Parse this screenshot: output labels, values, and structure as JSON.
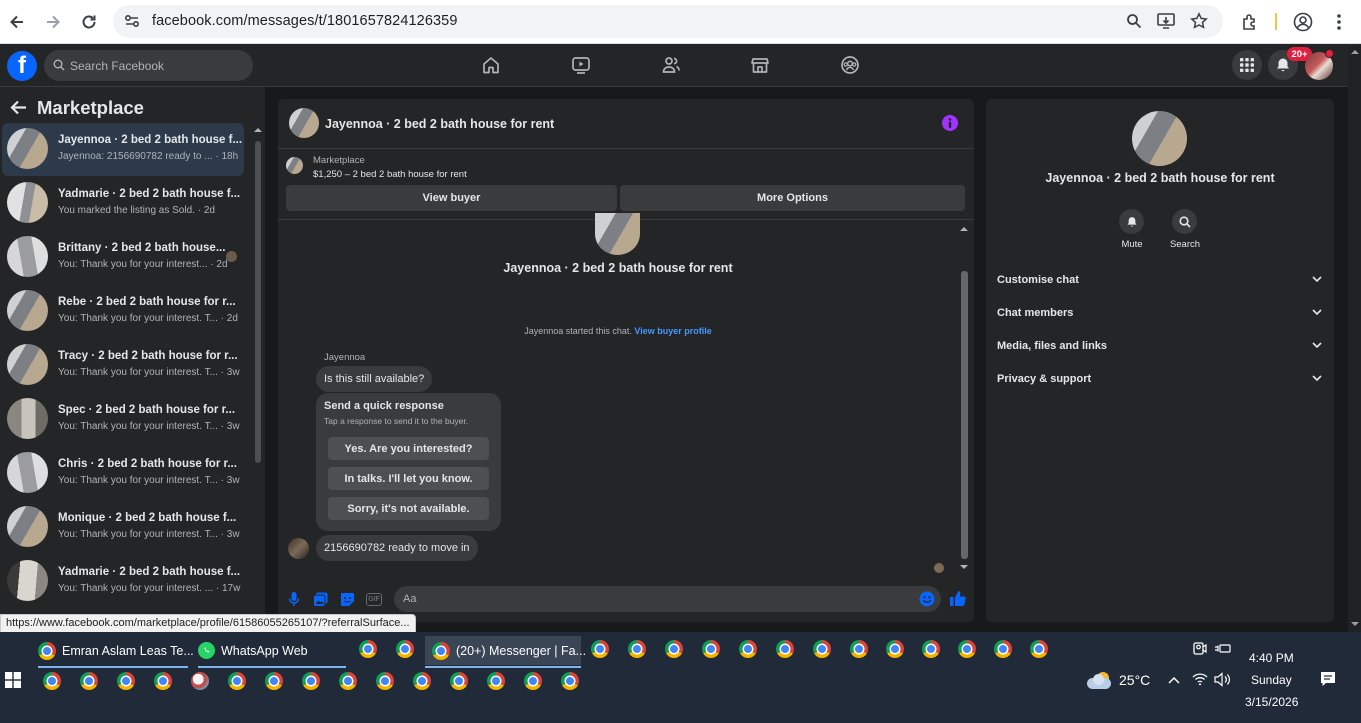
{
  "browser": {
    "url": "facebook.com/messages/t/1801657824126359"
  },
  "fb_header": {
    "search_placeholder": "Search Facebook",
    "notification_badge": "20+"
  },
  "sidebar": {
    "title": "Marketplace",
    "conversations": [
      {
        "title": "Jayennoa · 2 bed 2 bath house f...",
        "subtitle": "Jayennoa: 2156690782 ready to ... · 18h"
      },
      {
        "title": "Yadmarie · 2 bed 2 bath house f...",
        "subtitle": "You marked the listing as Sold. · 2d"
      },
      {
        "title": "Brittany · 2 bed 2 bath house...",
        "subtitle": "You: Thank you for your interest... · 2d"
      },
      {
        "title": "Rebe · 2 bed 2 bath house for r...",
        "subtitle": "You: Thank you for your interest. T... · 2d"
      },
      {
        "title": "Tracy · 2 bed 2 bath house for r...",
        "subtitle": "You: Thank you for your interest. T... · 3w"
      },
      {
        "title": "Spec · 2 bed 2 bath house for r...",
        "subtitle": "You: Thank you for your interest. T... · 3w"
      },
      {
        "title": "Chris · 2 bed 2 bath house for r...",
        "subtitle": "You: Thank you for your interest. T... · 3w"
      },
      {
        "title": "Monique · 2 bed 2 bath house f...",
        "subtitle": "You: Thank you for your interest. T... · 3w"
      },
      {
        "title": "Yadmarie · 2 bed 2 bath house f...",
        "subtitle": "You: Thank you for your interest. ... · 17w"
      }
    ]
  },
  "chat": {
    "header_title": "Jayennoa · 2 bed 2 bath house for rent",
    "listing_label": "Marketplace",
    "listing_text": "$1,250 – 2 bed 2 bath house for rent",
    "view_buyer": "View buyer",
    "more_options": "More Options",
    "intro_name": "Jayennoa · 2 bed 2 bath house for rent",
    "started_text": "Jayennoa started this chat.",
    "view_buyer_profile": "View buyer profile",
    "sender_name": "Jayennoa",
    "message1": "Is this still available?",
    "quick_title": "Send a quick response",
    "quick_sub": "Tap a response to send it to the buyer.",
    "quick_responses": [
      "Yes. Are you interested?",
      "In talks. I'll let you know.",
      "Sorry, it's not available."
    ],
    "message2": "2156690782 ready to move in",
    "composer_placeholder": "Aa"
  },
  "details": {
    "title": "Jayennoa · 2 bed 2 bath house for rent",
    "mute": "Mute",
    "search": "Search",
    "sections": [
      "Customise chat",
      "Chat members",
      "Media, files and links",
      "Privacy & support"
    ]
  },
  "status_url": "https://www.facebook.com/marketplace/profile/61586055265107/?referralSurface...",
  "taskbar": {
    "tasks": [
      "Emran Aslam Leas Te...",
      "WhatsApp Web",
      "(20+) Messenger | Fa..."
    ],
    "weather": "25°C",
    "time": "4:40 PM",
    "day": "Sunday",
    "date": "3/15/2026"
  },
  "colors": {
    "fb_blue": "#0866ff",
    "badge_red": "#e41e3f",
    "info_purple": "#a033ff",
    "link_blue": "#4599ff"
  }
}
